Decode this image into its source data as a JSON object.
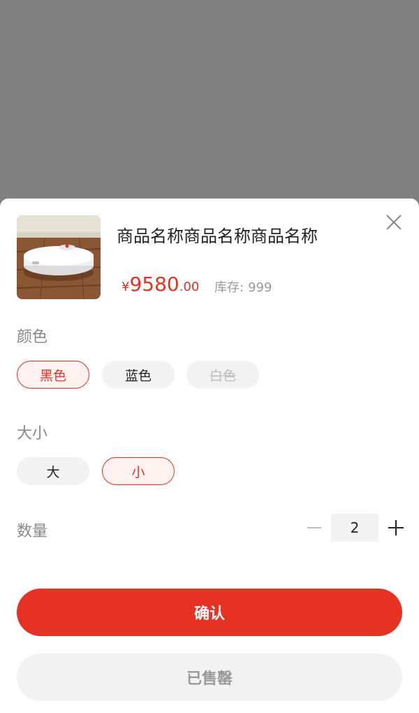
{
  "product": {
    "title": "商品名称商品名称商品名称",
    "price_currency": "¥",
    "price_integer": "9580",
    "price_decimal": ".00",
    "stock_label": "库存:",
    "stock_value": "999",
    "image_icon": "robot-vacuum-image"
  },
  "color_section": {
    "label": "颜色",
    "options": [
      {
        "label": "黑色",
        "state": "selected"
      },
      {
        "label": "蓝色",
        "state": "normal"
      },
      {
        "label": "白色",
        "state": "disabled"
      }
    ]
  },
  "size_section": {
    "label": "大小",
    "options": [
      {
        "label": "大",
        "state": "normal"
      },
      {
        "label": "小",
        "state": "selected"
      }
    ]
  },
  "quantity": {
    "label": "数量",
    "value": "2"
  },
  "buttons": {
    "confirm": "确认",
    "sold_out": "已售罄"
  },
  "colors": {
    "accent": "#e63222",
    "option_bg": "#f2f2f2",
    "overlay": "#808080"
  },
  "icons": {
    "close": "close-icon",
    "minus": "minus-icon",
    "plus": "plus-icon"
  }
}
